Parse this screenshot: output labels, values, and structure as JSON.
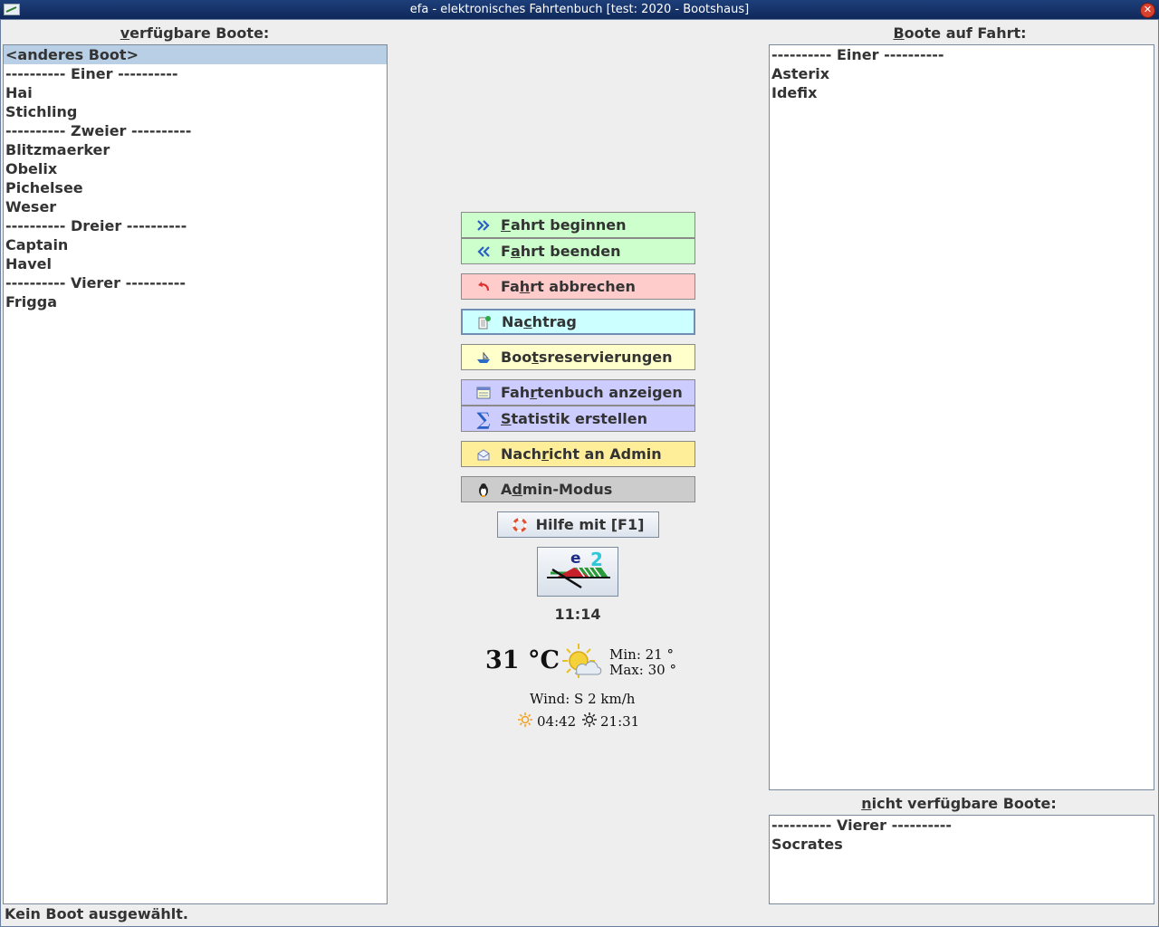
{
  "window": {
    "title": "efa - elektronisches Fahrtenbuch [test: 2020 - Bootshaus]"
  },
  "available": {
    "label_mnemonic": "v",
    "label_rest": "erfügbare Boote:",
    "items": [
      "<anderes Boot>",
      "---------- Einer ----------",
      "Hai",
      "Stichling",
      "---------- Zweier ----------",
      "Blitzmaerker",
      "Obelix",
      "Pichelsee",
      "Weser",
      "---------- Dreier ----------",
      "Captain",
      "Havel",
      "---------- Vierer ----------",
      "Frigga"
    ],
    "selected_index": 0
  },
  "on_trip": {
    "label_mnemonic": "B",
    "label_rest": "oote auf Fahrt:",
    "items": [
      "---------- Einer ----------",
      "Asterix",
      "Idefix"
    ]
  },
  "unavailable": {
    "label_mnemonic": "n",
    "label_rest": "icht verfügbare Boote:",
    "items": [
      "---------- Vierer ----------",
      "Socrates"
    ]
  },
  "buttons": {
    "start": {
      "pre": "",
      "mn": "F",
      "post": "ahrt beginnen",
      "icon": "double-chevron-right-icon"
    },
    "end": {
      "pre": "F",
      "mn": "a",
      "post": "hrt beenden",
      "icon": "double-chevron-left-icon"
    },
    "abort": {
      "pre": "Fa",
      "mn": "h",
      "post": "rt abbrechen",
      "icon": "undo-arrow-icon"
    },
    "late_entry": {
      "pre": "Na",
      "mn": "c",
      "post": "htrag",
      "icon": "notepad-pin-icon"
    },
    "reservations": {
      "pre": "Boo",
      "mn": "t",
      "post": "sreservierungen",
      "icon": "boat-icon"
    },
    "logbook": {
      "pre": "Fah",
      "mn": "r",
      "post": "tenbuch anzeigen",
      "icon": "list-window-icon"
    },
    "statistics": {
      "pre": "",
      "mn": "S",
      "post": "tatistik erstellen",
      "icon": "sigma-icon"
    },
    "message": {
      "pre": "Nach",
      "mn": "r",
      "post": "icht an Admin",
      "icon": "envelope-icon"
    },
    "admin": {
      "pre": "A",
      "mn": "d",
      "post": "min-Modus",
      "icon": "penguin-icon"
    },
    "help": {
      "label": "Hilfe mit [F1]",
      "icon": "lifebuoy-icon"
    }
  },
  "clock": "11:14",
  "weather": {
    "temperature": "31 °C",
    "min": "Min: 21 °",
    "max": "Max: 30 °",
    "wind": "Wind: S 2 km/h",
    "sunrise": "04:42",
    "sunset": "21:31",
    "icon": "sun-cloud-icon"
  },
  "status": "Kein Boot ausgewählt.",
  "colors": {
    "titlebar": "#1d3f7a",
    "selection": "#b8cfe5",
    "green_button": "#ccffcc",
    "red_button": "#ffcccc",
    "cyan_button": "#ccffff",
    "yellow_button": "#ffffcc",
    "lavender_button": "#ccccff",
    "gold_button": "#ffee99",
    "grey_button": "#cccccc"
  }
}
